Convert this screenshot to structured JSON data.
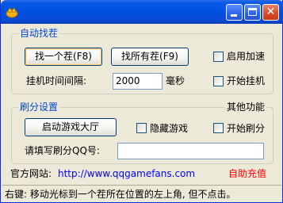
{
  "titlebar": {
    "icon": "app-gold-icon",
    "buttons": [
      "minimize",
      "maximize",
      "close"
    ]
  },
  "auto_group": {
    "title": "自动找茬",
    "find_one_button": "找一个茬(F8)",
    "find_all_button": "找所有茬(F9)",
    "enable_speedup": "启用加速",
    "hang_interval_label": "挂机时间间隔:",
    "hang_interval_value": "2000",
    "unit": "毫秒",
    "start_hang": "开始挂机"
  },
  "score_group": {
    "title": "刷分设置",
    "launch_hall_button": "启动游戏大厅",
    "hide_game": "隐藏游戏",
    "qq_label": "请填写刷分QQ号:",
    "qq_value": ""
  },
  "other": {
    "title": "其他功能",
    "start_score": "开始刷分"
  },
  "footer": {
    "website_label": "官方网站:",
    "website_url": "http://www.qqgamefans.com",
    "auto_recharge": "自助充值",
    "status_text": "右键: 移动光标到一个茬所在位置的左上角, 但不点击。"
  },
  "colors": {
    "group_title": "#0046d5",
    "link": "#0000ff",
    "recharge": "#ff0000",
    "titlebar": "#0050e0"
  }
}
